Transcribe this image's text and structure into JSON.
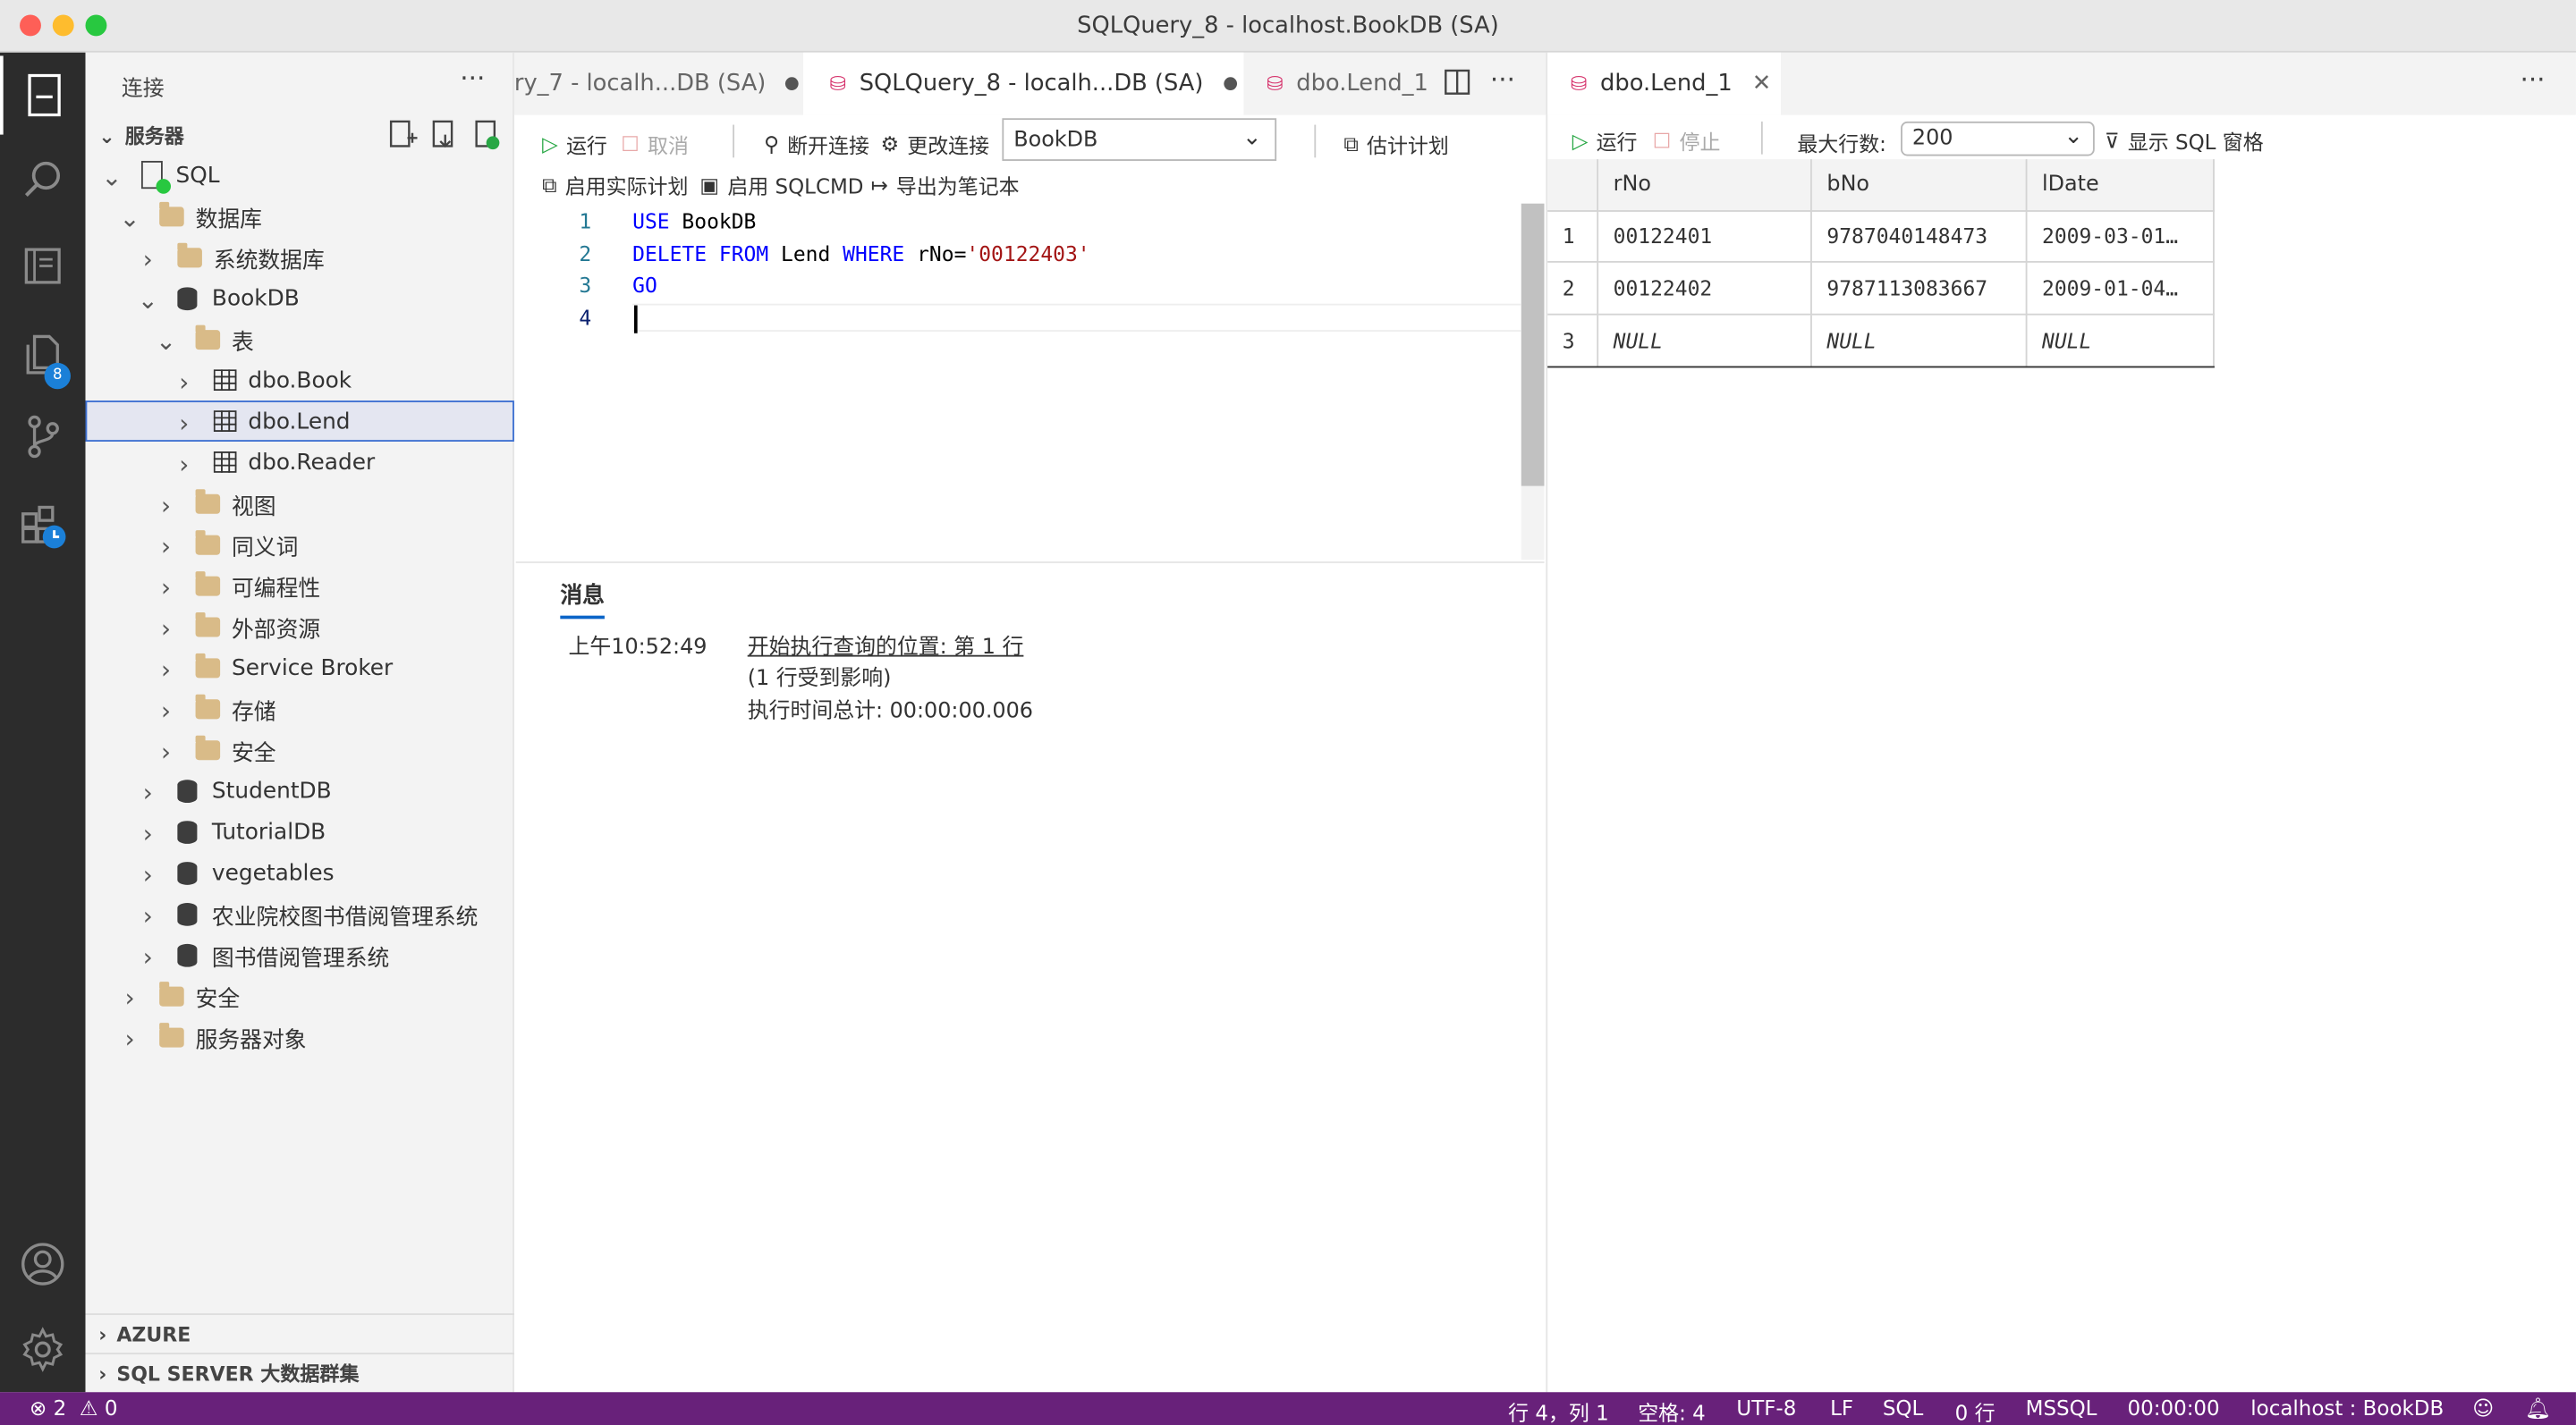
{
  "window": {
    "title": "SQLQuery_8 - localhost.BookDB (SA)"
  },
  "activity": {
    "extensions_badge": "8"
  },
  "sidebar": {
    "header": "连接",
    "section": "服务器",
    "tree": [
      {
        "label": "SQL",
        "icon": "server-icon"
      },
      {
        "label": "数据库",
        "icon": "folder-icon"
      },
      {
        "label": "系统数据库",
        "icon": "folder-icon"
      },
      {
        "label": "BookDB",
        "icon": "database-icon"
      },
      {
        "label": "表",
        "icon": "folder-icon"
      },
      {
        "label": "dbo.Book",
        "icon": "table-icon"
      },
      {
        "label": "dbo.Lend",
        "icon": "table-icon"
      },
      {
        "label": "dbo.Reader",
        "icon": "table-icon"
      },
      {
        "label": "视图",
        "icon": "folder-icon"
      },
      {
        "label": "同义词",
        "icon": "folder-icon"
      },
      {
        "label": "可编程性",
        "icon": "folder-icon"
      },
      {
        "label": "外部资源",
        "icon": "folder-icon"
      },
      {
        "label": "Service Broker",
        "icon": "folder-icon"
      },
      {
        "label": "存储",
        "icon": "folder-icon"
      },
      {
        "label": "安全",
        "icon": "folder-icon"
      },
      {
        "label": "StudentDB",
        "icon": "database-icon"
      },
      {
        "label": "TutorialDB",
        "icon": "database-icon"
      },
      {
        "label": "vegetables",
        "icon": "database-icon"
      },
      {
        "label": "农业院校图书借阅管理系统",
        "icon": "database-icon"
      },
      {
        "label": "图书借阅管理系统",
        "icon": "database-icon"
      },
      {
        "label": "安全",
        "icon": "folder-icon"
      },
      {
        "label": "服务器对象",
        "icon": "folder-icon"
      }
    ],
    "azure": "AZURE",
    "bigdata": "SQL SERVER 大数据群集"
  },
  "editor_tabs": [
    {
      "label": "ry_7 - localh...DB (SA)"
    },
    {
      "label": "SQLQuery_8 - localh...DB (SA)"
    },
    {
      "label": "dbo.Lend_1"
    }
  ],
  "toolbar": {
    "run": "运行",
    "cancel": "取消",
    "disconnect": "断开连接",
    "change_connection": "更改连接",
    "database": "BookDB",
    "estimated_plan": "估计计划",
    "actual_plan": "启用实际计划",
    "sqlcmd": "启用 SQLCMD",
    "export_notebook": "导出为笔记本"
  },
  "code": {
    "line_numbers": [
      "1",
      "2",
      "3",
      "4"
    ],
    "l1_kw": "USE",
    "l1_rest": " BookDB",
    "l2_kw1": "DELETE",
    "l2_kw2": " FROM",
    "l2_mid": " Lend ",
    "l2_kw3": "WHERE",
    "l2_cond": " rNo=",
    "l2_str": "'00122403'",
    "l3_kw": "GO"
  },
  "messages": {
    "tab": "消息",
    "time": "上午10:52:49",
    "line1": "开始执行查询的位置: 第 1 行",
    "line2": "(1 行受到影响)",
    "line3": "执行时间总计: 00:00:00.006"
  },
  "results": {
    "tab": "dbo.Lend_1",
    "run": "运行",
    "stop": "停止",
    "max_rows_label": "最大行数:",
    "max_rows_value": "200",
    "show_sql": "显示 SQL 窗格",
    "columns": [
      "rNo",
      "bNo",
      "lDate"
    ],
    "rows": [
      {
        "num": "1",
        "rNo": "00122401",
        "bNo": "9787040148473",
        "lDate": "2009-03-01…"
      },
      {
        "num": "2",
        "rNo": "00122402",
        "bNo": "9787113083667",
        "lDate": "2009-01-04…"
      },
      {
        "num": "3",
        "rNo": "NULL",
        "bNo": "NULL",
        "lDate": "NULL"
      }
    ]
  },
  "status": {
    "errors": "2",
    "warnings": "0",
    "position": "行 4，列 1",
    "spaces": "空格: 4",
    "encoding": "UTF-8",
    "eol": "LF",
    "language": "SQL",
    "rows": "0 行",
    "provider": "MSSQL",
    "elapsed": "00:00:00",
    "connection": "localhost : BookDB"
  },
  "colors": {
    "accent": "#68217a",
    "selection_outline": "#3c6fd1",
    "keyword": "#0000ff",
    "string": "#a31515"
  }
}
